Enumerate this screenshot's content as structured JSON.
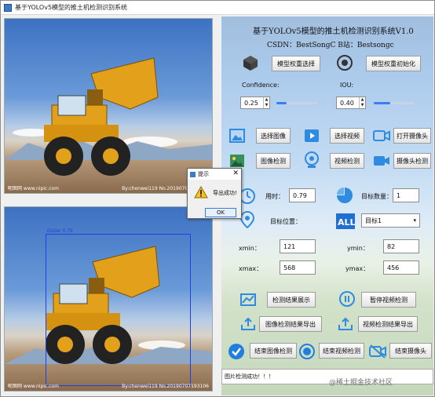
{
  "window": {
    "title": "基于YOLOv5模型的推土机检测识别系统"
  },
  "header": {
    "title": "基于YOLOv5模型的推土机检测识别系统V1.0",
    "subtitle": "CSDN：BestSongC  B站：Bestsongc"
  },
  "model": {
    "select_label": "模型权重选择",
    "init_label": "模型权重初始化"
  },
  "params": {
    "confidence_label": "Confidence:",
    "confidence_value": "0.25",
    "confidence_level": 0.25,
    "iou_label": "IOU:",
    "iou_value": "0.40",
    "iou_level": 0.4
  },
  "source": {
    "select_image": "选择图像",
    "select_video": "选择视频",
    "open_camera": "打开摄像头",
    "image_detect": "图像检测",
    "video_detect": "视频检测",
    "camera_detect": "摄像头检测"
  },
  "result": {
    "time_label": "用时：",
    "time_value": "0.79",
    "count_label": "目标数量：",
    "count_value": "1",
    "position_label": "目标位置：",
    "target_select": "目标1",
    "xmin_label": "xmin：",
    "xmin_value": "121",
    "ymin_label": "ymin：",
    "ymin_value": "82",
    "xmax_label": "xmax：",
    "xmax_value": "568",
    "ymax_label": "ymax：",
    "ymax_value": "456"
  },
  "actions": {
    "show_results": "检测结果展示",
    "pause_video": "暂停视频检测",
    "export_image": "图像检测结果导出",
    "export_video": "视频检测结果导出",
    "end_image": "结束图像检测",
    "end_video": "结束视频检测",
    "end_camera": "结束摄像头"
  },
  "status": {
    "text": "图片检测成功！！！"
  },
  "detection": {
    "label": "Dozer 0.79"
  },
  "image_watermark": {
    "left": "昵图网 www.nipic.com",
    "right": "By:chenwei119 No.20190707193106"
  },
  "dialog": {
    "title": "提示",
    "message": "导出成功!",
    "ok_label": "OK"
  },
  "page_watermark": "@稀土掘金技术社区",
  "colors": {
    "accent": "#3a7ff0",
    "box": "#2040e0",
    "icon_blue": "#2e8be0"
  },
  "icons": [
    "cube-icon",
    "target-icon",
    "image-icon",
    "video-icon",
    "camera-icon",
    "photo-detect-icon",
    "webcam-icon",
    "video-camera-icon",
    "clock-icon",
    "pie-chart-icon",
    "location-pin-icon",
    "all-icon",
    "chart-icon",
    "pause-icon",
    "upload-icon",
    "check-circle-icon",
    "stop-icon",
    "camera-off-icon",
    "warning-icon",
    "close-icon"
  ]
}
